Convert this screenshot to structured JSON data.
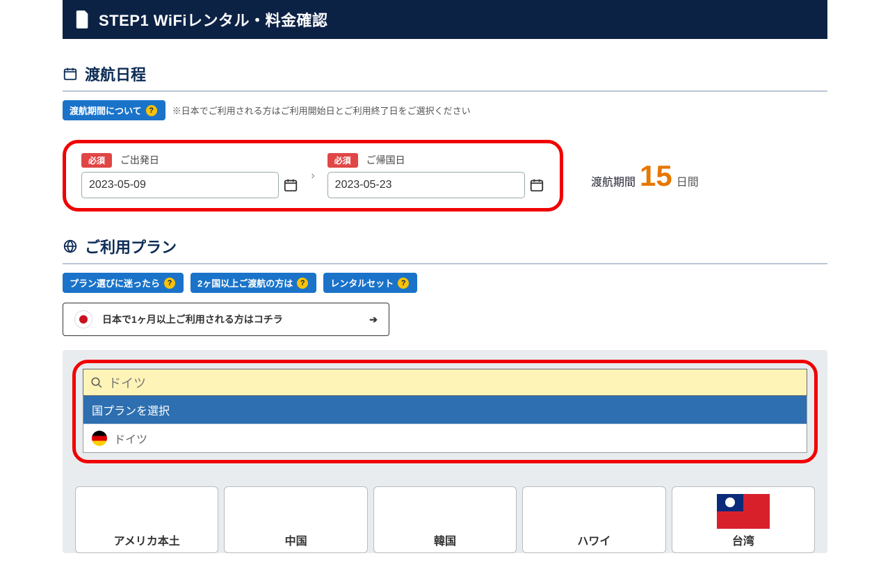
{
  "header": {
    "title": "STEP1 WiFiレンタル・料金確認"
  },
  "travel": {
    "section_title": "渡航日程",
    "pill_period": "渡航期間について",
    "note": "※日本でご利用される方はご利用開始日とご利用終了日をご選択ください",
    "required_tag": "必須",
    "dep_label": "ご出発日",
    "ret_label": "ご帰国日",
    "dep_value": "2023-05-09",
    "ret_value": "2023-05-23",
    "period_label": "渡航期間",
    "period_days": "15",
    "period_unit": "日間"
  },
  "plan": {
    "section_title": "ご利用プラン",
    "pill_tips": "プラン選びに迷ったら",
    "pill_multi": "2ヶ国以上ご渡航の方は",
    "pill_set": "レンタルセット",
    "jp_cta": "日本で1ヶ月以上ご利用される方はコチラ",
    "search": {
      "query": "ドイツ",
      "dd_header": "国プランを選択",
      "dd_item1": "ドイツ"
    },
    "tabs": {
      "us": "アメリカ本土",
      "cn": "中国",
      "kr": "韓国",
      "hw": "ハワイ",
      "tw": "台湾"
    }
  }
}
